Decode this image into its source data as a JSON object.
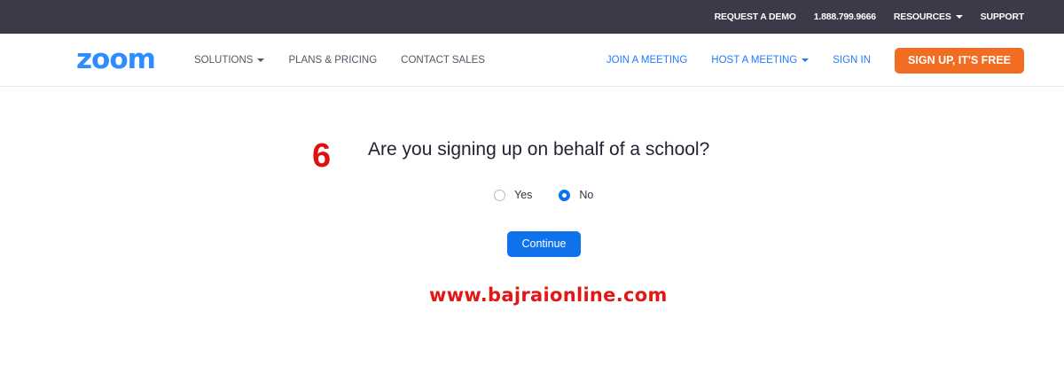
{
  "topbar": {
    "request_demo": "REQUEST A DEMO",
    "phone": "1.888.799.9666",
    "resources": "RESOURCES",
    "support": "SUPPORT"
  },
  "nav": {
    "logo": "zoom",
    "solutions": "SOLUTIONS",
    "plans_pricing": "PLANS & PRICING",
    "contact_sales": "CONTACT SALES",
    "join_meeting": "JOIN A MEETING",
    "host_meeting": "HOST A MEETING",
    "sign_in": "SIGN IN",
    "sign_up": "SIGN UP, IT'S FREE"
  },
  "form": {
    "step": "6",
    "question": "Are you signing up on behalf of a school?",
    "options": [
      {
        "label": "Yes",
        "checked": false
      },
      {
        "label": "No",
        "checked": true
      }
    ],
    "continue_label": "Continue"
  },
  "watermark": "www.bajraionline.com",
  "colors": {
    "topbar_bg": "#3a3a48",
    "brand_blue": "#2d8cff",
    "link_blue": "#1f7bff",
    "signup_orange": "#f26d21",
    "button_blue": "#0e72ed",
    "annotation_red": "#e01010"
  }
}
